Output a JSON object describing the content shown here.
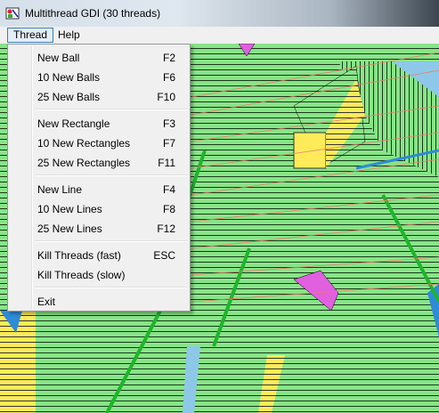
{
  "window": {
    "title": "Multithread GDI (30 threads)",
    "icon": "app-icon"
  },
  "menubar": {
    "items": [
      {
        "label": "Thread"
      },
      {
        "label": "Help"
      }
    ]
  },
  "thread_menu": {
    "items": [
      {
        "label": "New Ball",
        "shortcut": "F2"
      },
      {
        "label": "10 New Balls",
        "shortcut": "F6"
      },
      {
        "label": "25 New Balls",
        "shortcut": "F10"
      },
      {
        "label": "New Rectangle",
        "shortcut": "F3"
      },
      {
        "label": "10 New Rectangles",
        "shortcut": "F7"
      },
      {
        "label": "25 New Rectangles",
        "shortcut": "F11"
      },
      {
        "label": "New Line",
        "shortcut": "F4"
      },
      {
        "label": "10 New Lines",
        "shortcut": "F8"
      },
      {
        "label": "25 New Lines",
        "shortcut": "F12"
      },
      {
        "label": "Kill Threads (fast)",
        "shortcut": "ESC"
      },
      {
        "label": "Kill Threads (slow)",
        "shortcut": ""
      },
      {
        "label": "Exit",
        "shortcut": ""
      }
    ]
  },
  "colors": {
    "canvas_green": "#88e488",
    "shape_outline": "#000000",
    "line_salmon": "#f07a6a",
    "accent_yellow": "#ffeb5a",
    "accent_magenta": "#e060e0",
    "accent_blue": "#2e8bd8",
    "accent_cyan": "#8ec8e8"
  }
}
